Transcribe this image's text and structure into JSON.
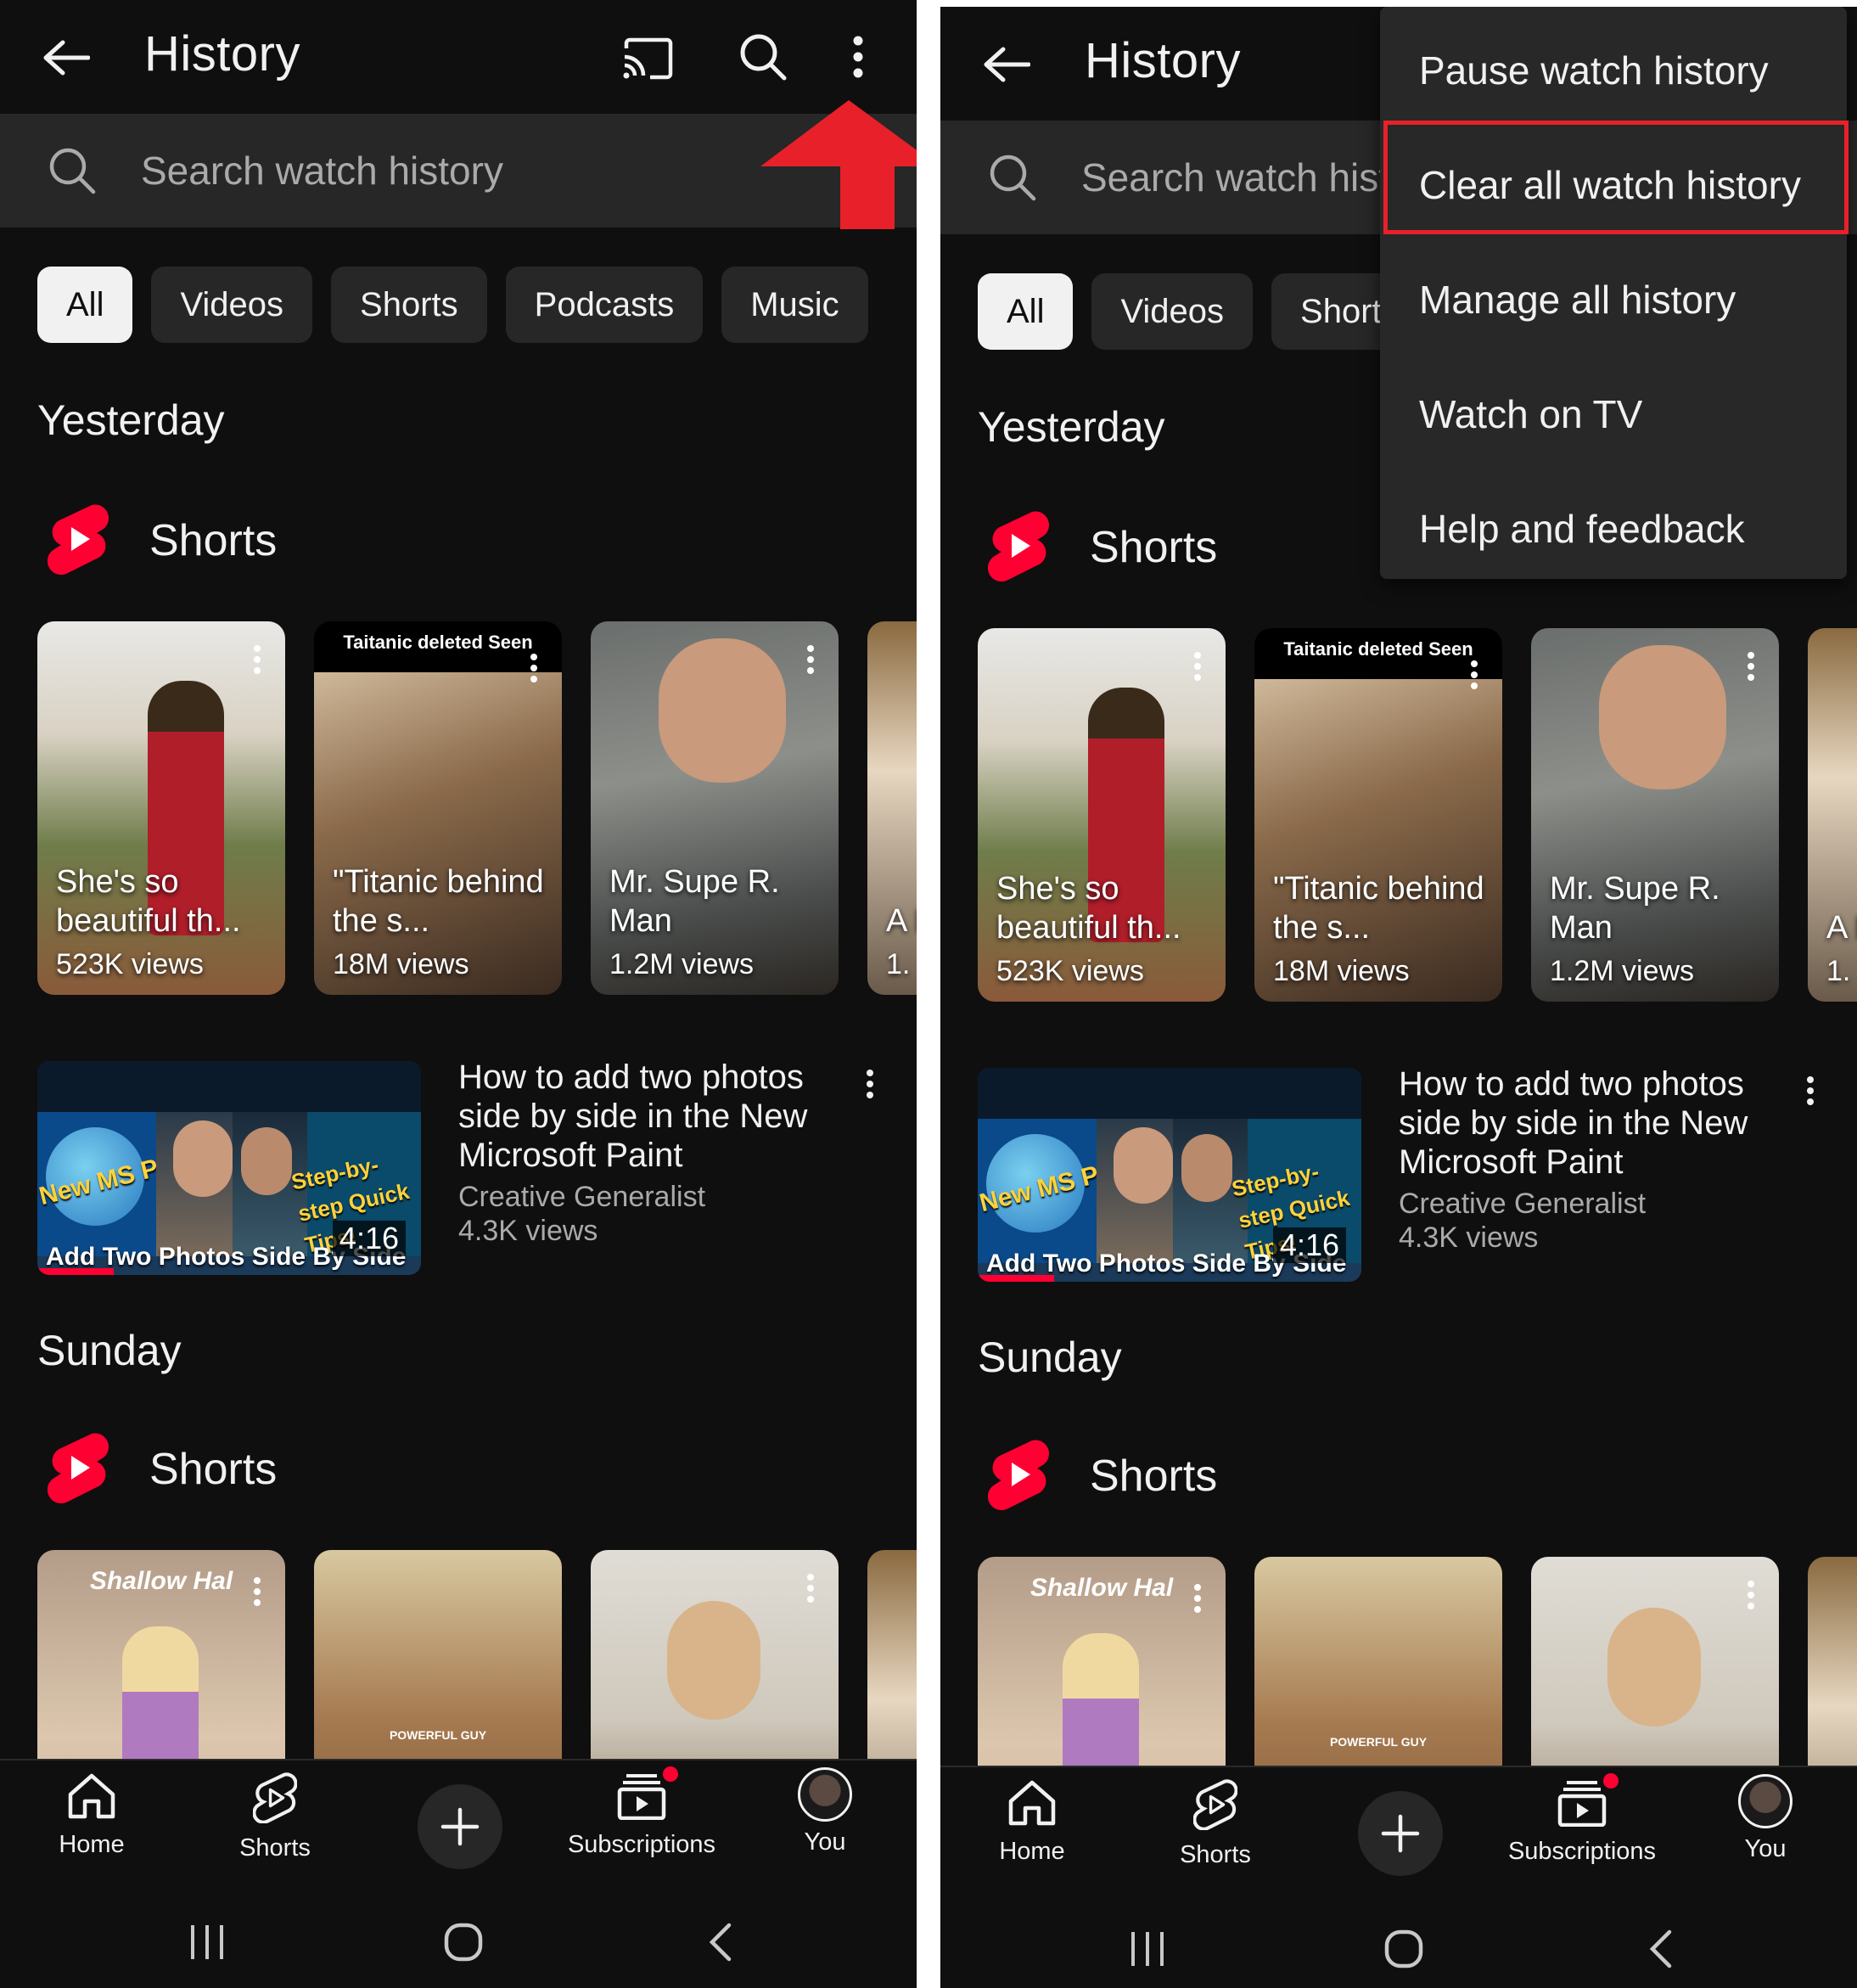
{
  "title": "History",
  "search_placeholder": "Search watch history",
  "search_placeholder_truncated": "Search watch hist",
  "chips": [
    "All",
    "Videos",
    "Shorts",
    "Podcasts",
    "Music"
  ],
  "chips_truncated_third": "Short",
  "sections": {
    "yesterday": "Yesterday",
    "sunday": "Sunday",
    "shorts_label": "Shorts"
  },
  "yesterday_shorts": [
    {
      "title": "She's so beautiful th...",
      "views": "523K views",
      "top_caption": ""
    },
    {
      "title": "\"Titanic behind the s...",
      "views": "18M views",
      "top_caption": "Taitanic deleted Seen"
    },
    {
      "title": "Mr. Supe R. Man",
      "views": "1.2M views",
      "top_caption": ""
    },
    {
      "title": "A hi",
      "views": "1.",
      "top_caption": ""
    }
  ],
  "video": {
    "title": "How to add two photos side by side in the New Microsoft Paint",
    "channel": "Creative Generalist",
    "views": "4.3K views",
    "duration": "4:16",
    "thumb_caption": "Add Two Photos Side By Side",
    "thumb_left": "New MS Paint",
    "thumb_right": "Step-by-step Quick Tips!"
  },
  "sunday_shorts": [
    {
      "top_caption": "Shallow Hal"
    },
    {
      "top_caption": "POWERFUL GUY"
    },
    {
      "top_caption": ""
    },
    {
      "top_caption": ""
    }
  ],
  "bottom_nav": {
    "home": "Home",
    "shorts": "Shorts",
    "subscriptions": "Subscriptions",
    "you": "You"
  },
  "menu": [
    "Pause watch history",
    "Clear all watch history",
    "Manage all history",
    "Watch on TV",
    "Help and feedback"
  ],
  "colors": {
    "background": "#0f0f0f",
    "surface": "#272727",
    "menu": "#282828",
    "accent_red": "#ff0033",
    "annotation_red": "#e8202a",
    "text": "#f1f1f1",
    "muted": "#aaaaaa"
  },
  "icons": [
    "back-arrow-icon",
    "cast-icon",
    "search-icon",
    "more-vert-icon",
    "shorts-logo-icon",
    "home-icon",
    "shorts-icon",
    "create-icon",
    "subscriptions-icon",
    "recents-icon",
    "home-circle-icon",
    "back-chevron-icon"
  ]
}
